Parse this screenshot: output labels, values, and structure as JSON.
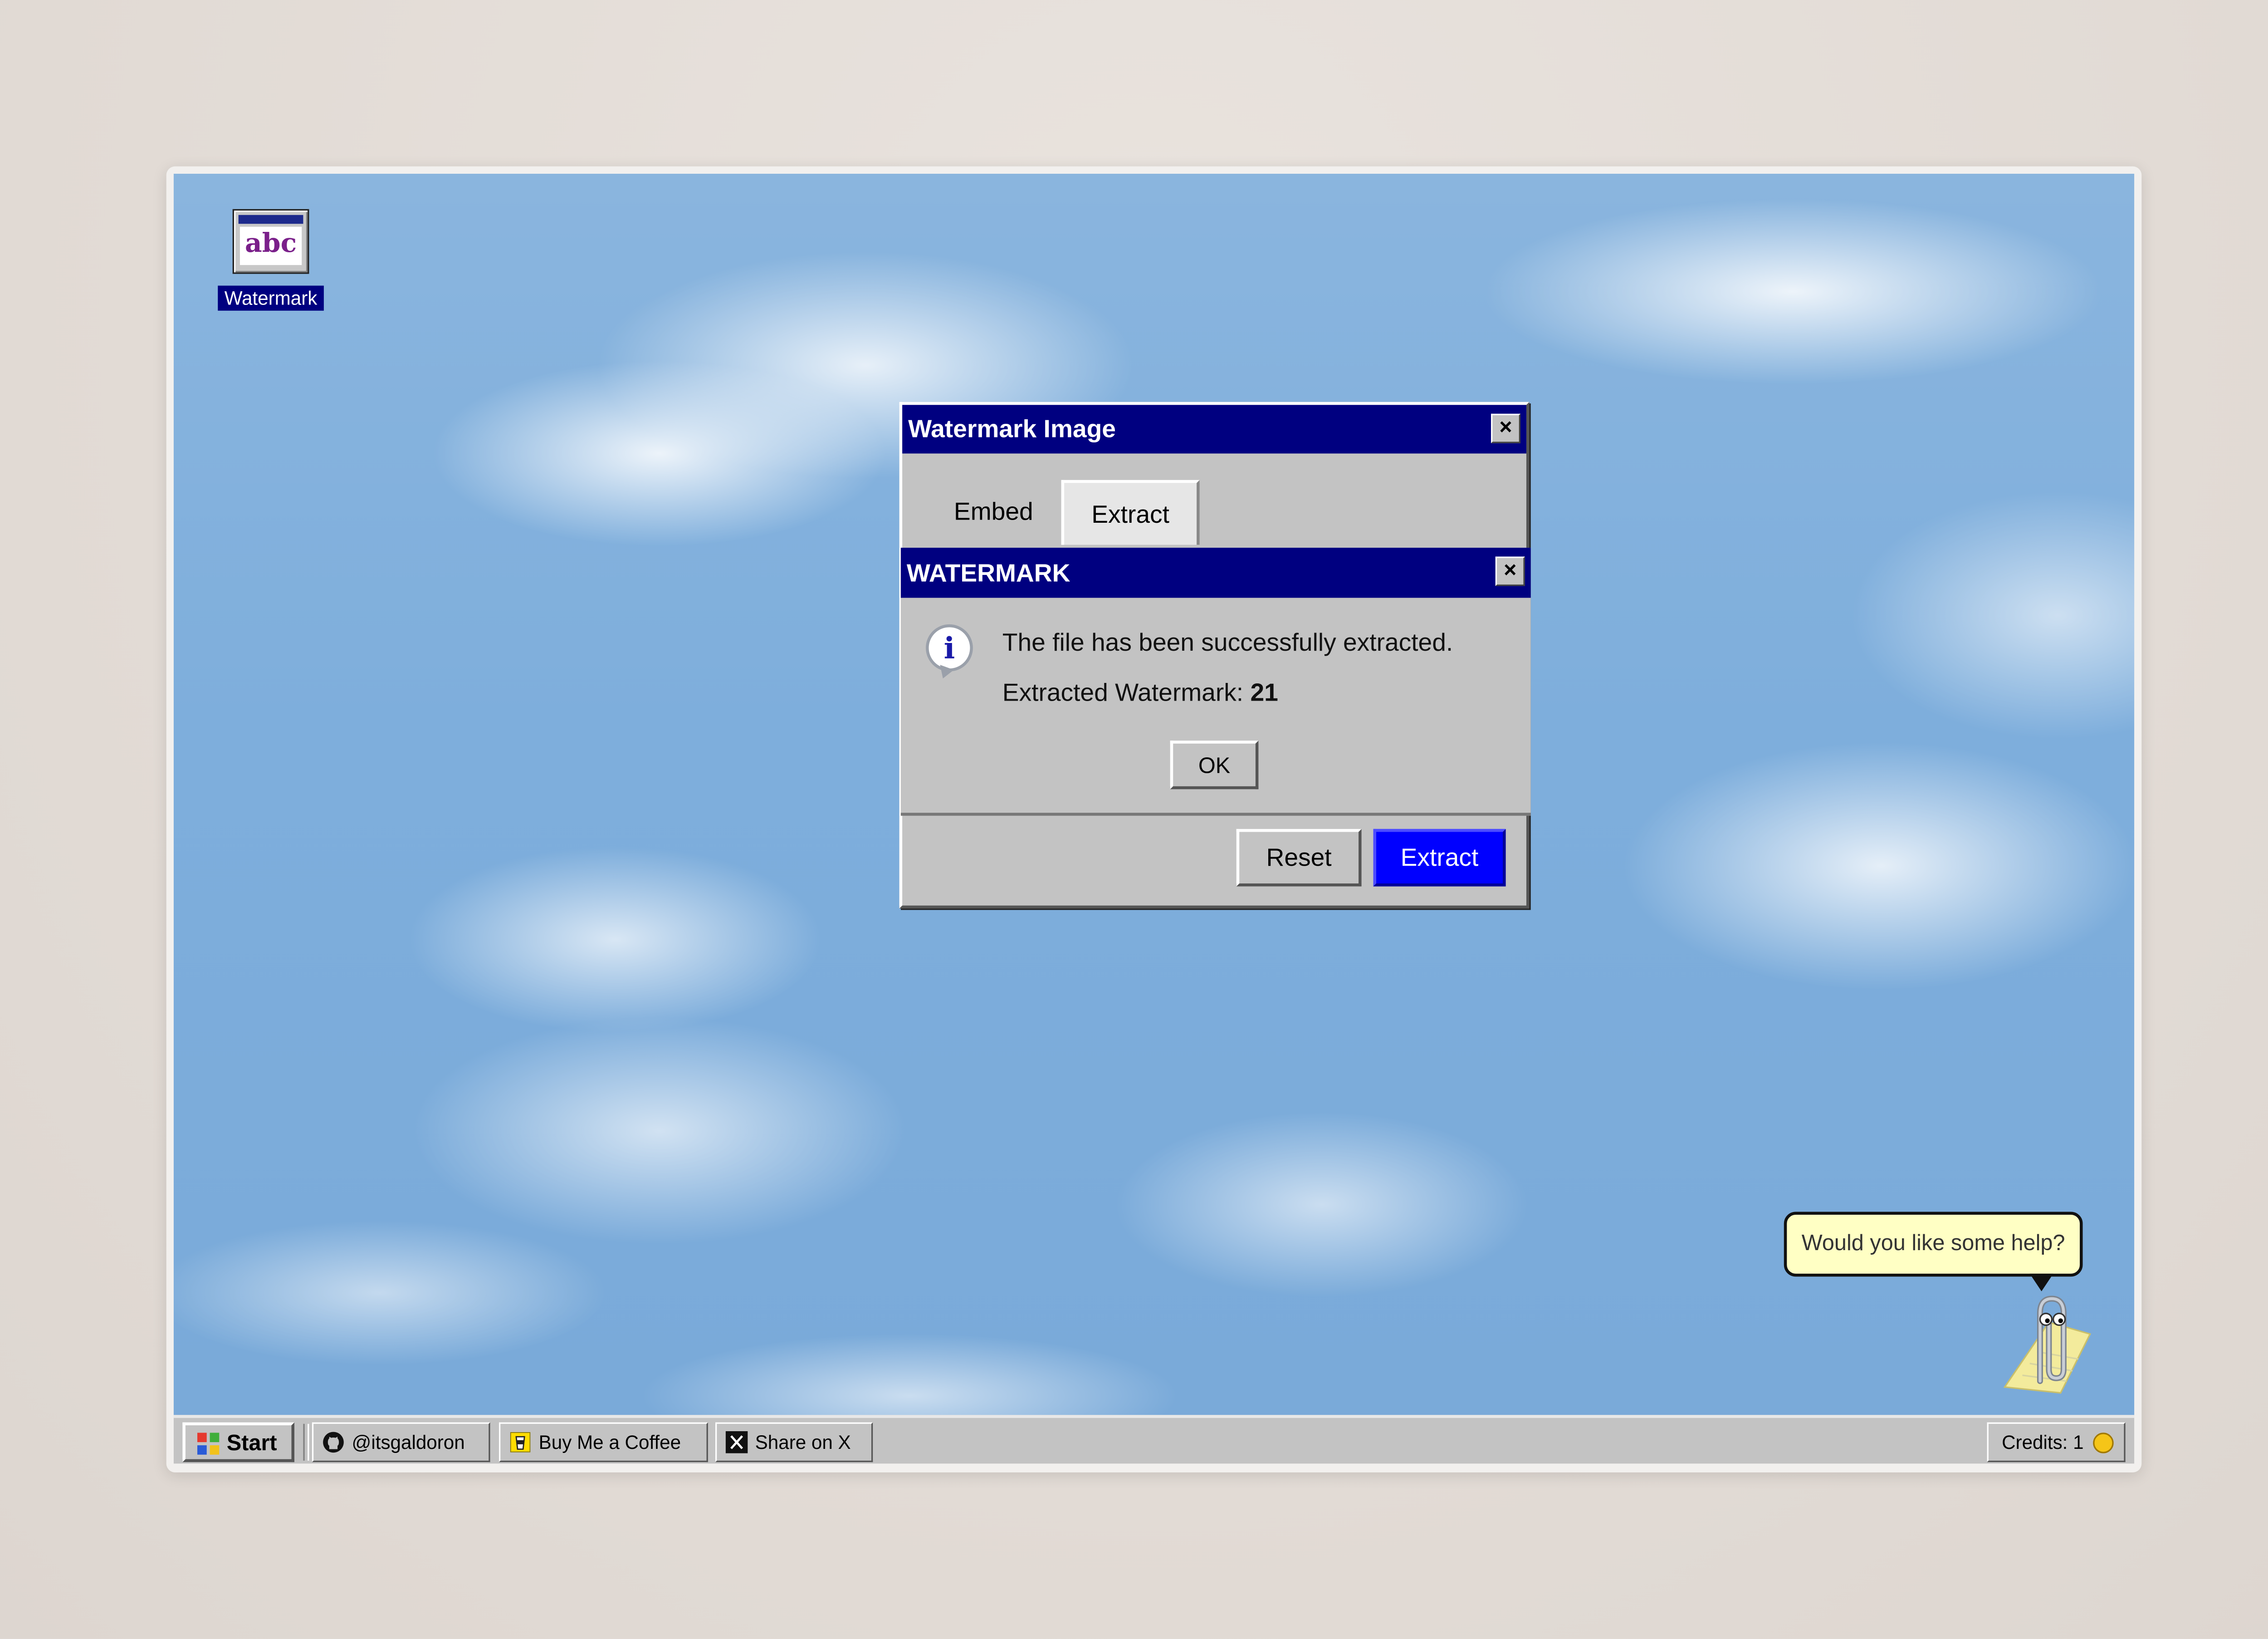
{
  "desktop": {
    "icon_label": "Watermark",
    "icon_glyph_text": "abc"
  },
  "window": {
    "title": "Watermark Image",
    "close_label": "×",
    "tabs": [
      {
        "label": "Embed",
        "active": false
      },
      {
        "label": "Extract",
        "active": true
      }
    ],
    "reset_label": "Reset",
    "extract_label": "Extract",
    "accent_color": "#0000ff"
  },
  "dialog": {
    "title": "WATERMARK",
    "close_label": "×",
    "icon": "info-icon",
    "message": "The file has been successfully extracted.",
    "watermark_label": "Extracted Watermark:",
    "watermark_value": "21",
    "ok_label": "OK"
  },
  "assistant": {
    "bubble_text": "Would you like some help?",
    "icon": "paperclip-assistant-icon"
  },
  "taskbar": {
    "start_label": "Start",
    "items": [
      {
        "label": "@itsgaldoron",
        "icon": "github-icon"
      },
      {
        "label": "Buy Me a Coffee",
        "icon": "coffee-icon"
      },
      {
        "label": "Share on X",
        "icon": "x-icon"
      }
    ],
    "credits_label": "Credits: 1",
    "credits_icon": "coin-icon"
  },
  "colors": {
    "titlebar": "#000080",
    "window_face": "#c3c3c3",
    "bubble": "#ffffc4"
  }
}
